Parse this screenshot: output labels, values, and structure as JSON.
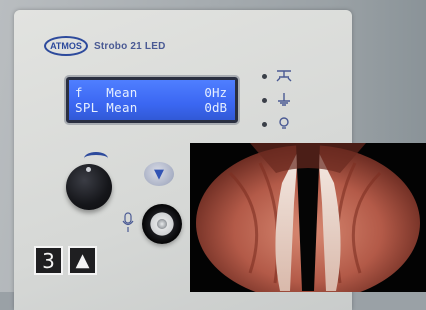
{
  "device": {
    "brand": "ATMOS",
    "model": "Strobo 21 LED",
    "lcd": {
      "row1_left": "f   Mean",
      "row1_right": "0Hz",
      "row2_left": "SPL Mean",
      "row2_right": "0dB"
    },
    "indicators": [
      "footswitch-icon",
      "ground-icon",
      "light-icon"
    ],
    "knob_icon": "rotary-knob-icon",
    "button_icon": "arrow-down-icon",
    "jack_icon": "microphone-jack-icon"
  },
  "navigation": {
    "page_number": "3",
    "up_icon": "▲"
  },
  "inset_image": "vocal-folds-endoscopy"
}
